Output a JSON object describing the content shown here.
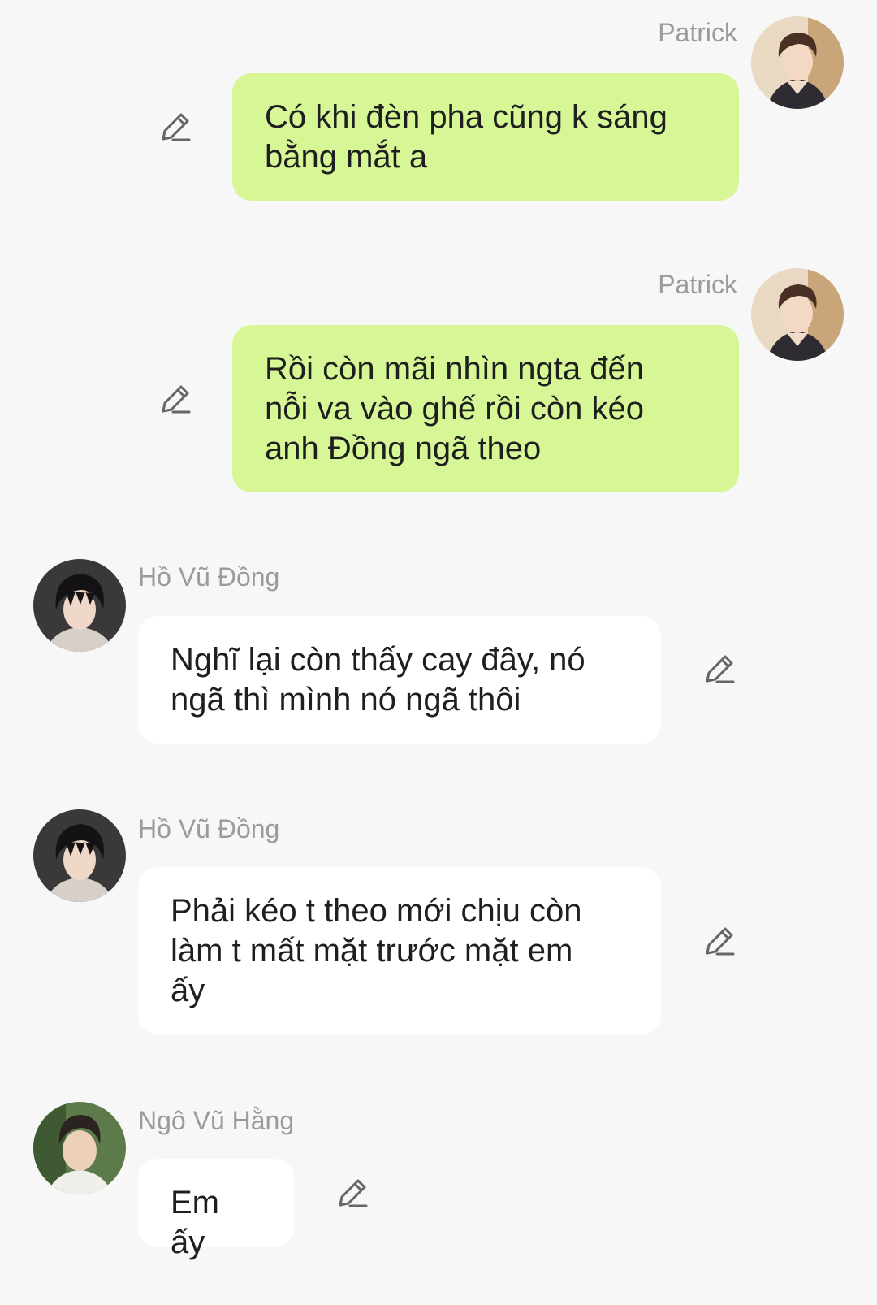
{
  "colors": {
    "page_background": "#f7f7f7",
    "outgoing_bubble": "#d7f797",
    "incoming_bubble": "#ffffff",
    "sender_name": "#9b9b9b",
    "message_text": "#1f1f1f",
    "icon_stroke": "#666666"
  },
  "messages": [
    {
      "direction": "outgoing",
      "sender": "Patrick",
      "text": "Có khi đèn pha cũng k sáng\nbằng mắt a",
      "avatar_icon": "avatar-photo",
      "action_icon": "pencil-edit-icon"
    },
    {
      "direction": "outgoing",
      "sender": "Patrick",
      "text": "Rồi còn mãi nhìn ngta đến\nnỗi va vào ghế rồi còn kéo\nanh Đồng ngã theo",
      "avatar_icon": "avatar-photo",
      "action_icon": "pencil-edit-icon"
    },
    {
      "direction": "incoming",
      "sender": "Hồ Vũ Đồng",
      "text": "Nghĩ lại còn thấy cay đây, nó\nngã thì mình nó ngã thôi",
      "avatar_icon": "avatar-photo",
      "action_icon": "pencil-edit-icon"
    },
    {
      "direction": "incoming",
      "sender": "Hồ Vũ Đồng",
      "text": "Phải kéo t theo mới chịu còn\nlàm t mất mặt trước mặt em\nấy",
      "avatar_icon": "avatar-photo",
      "action_icon": "pencil-edit-icon"
    },
    {
      "direction": "incoming",
      "sender": "Ngô Vũ Hằng",
      "text": "Em ấy",
      "avatar_icon": "avatar-photo",
      "action_icon": "pencil-edit-icon"
    }
  ]
}
